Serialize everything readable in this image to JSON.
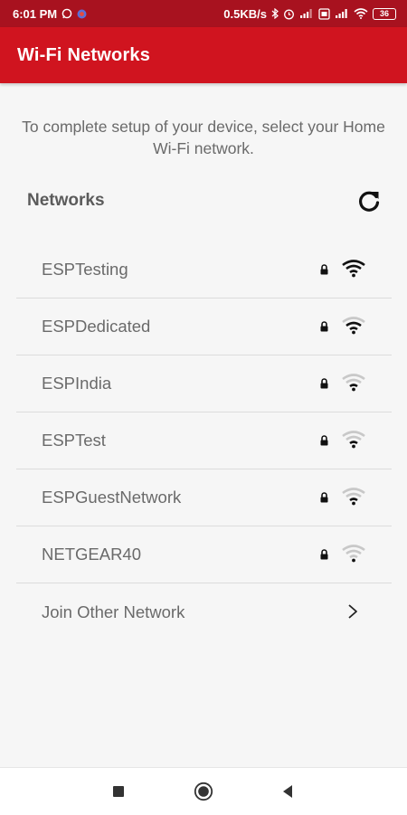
{
  "status_bar": {
    "time": "6:01 PM",
    "net_speed": "0.5KB/s",
    "battery": "36",
    "icons": [
      "whatsapp-icon",
      "app-notification-icon",
      "bluetooth-icon",
      "alarm-icon",
      "signal-icon",
      "sim-icon",
      "signal-icon",
      "wifi-icon",
      "battery-icon"
    ]
  },
  "app_bar": {
    "title": "Wi-Fi Networks"
  },
  "instructions": "To complete setup of your device, select your Home Wi-Fi network.",
  "networks_header": {
    "title": "Networks",
    "refresh_icon": "refresh-icon"
  },
  "networks": [
    {
      "ssid": "ESPTesting",
      "secured": true,
      "signal_bars": 4
    },
    {
      "ssid": "ESPDedicated",
      "secured": true,
      "signal_bars": 3
    },
    {
      "ssid": "ESPIndia",
      "secured": true,
      "signal_bars": 2
    },
    {
      "ssid": "ESPTest",
      "secured": true,
      "signal_bars": 2
    },
    {
      "ssid": "ESPGuestNetwork",
      "secured": true,
      "signal_bars": 2
    },
    {
      "ssid": "NETGEAR40",
      "secured": true,
      "signal_bars": 1
    }
  ],
  "join_other": {
    "label": "Join Other Network",
    "icon": "chevron-right-icon"
  },
  "nav_bar": {
    "icons": [
      "recents-square-icon",
      "home-circle-icon",
      "back-triangle-icon"
    ]
  },
  "colors": {
    "status_bar": "#a8121f",
    "app_bar": "#d0141f",
    "background": "#f6f6f6",
    "wifi_active": "#111111",
    "wifi_inactive": "#c8c8c8"
  }
}
